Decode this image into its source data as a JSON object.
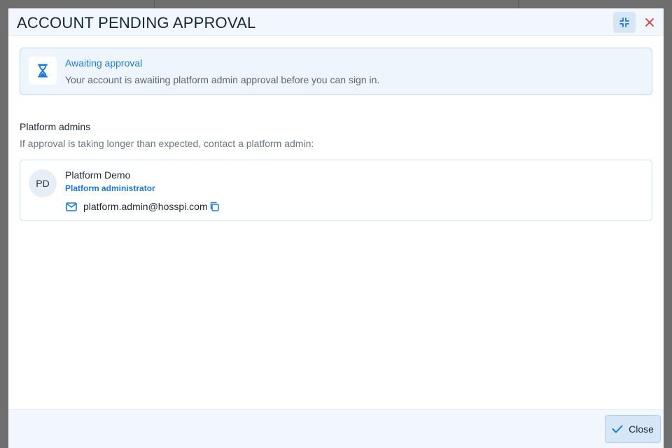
{
  "dialog": {
    "title": "ACCOUNT PENDING APPROVAL",
    "header_icons": {
      "minimize": "collapse-icon",
      "close": "close-icon"
    }
  },
  "notice": {
    "icon": "hourglass-icon",
    "title": "Awaiting approval",
    "text": "Your account is awaiting platform admin approval before you can sign in."
  },
  "admins_section": {
    "title": "Platform admins",
    "subtitle": "If approval is taking longer than expected, contact a platform admin:",
    "admins": [
      {
        "initials": "PD",
        "name": "Platform Demo",
        "role": "Platform administrator",
        "email": "platform.admin@hosspi.com",
        "email_icon": "mail-icon",
        "copy_icon": "copy-icon"
      }
    ]
  },
  "footer": {
    "close_label": "Close",
    "close_icon": "check-icon"
  },
  "colors": {
    "accent": "#1a7ad9",
    "danger": "#e0392b",
    "header_bg": "#f2f7fd",
    "backdrop": "#6e6e6e"
  }
}
